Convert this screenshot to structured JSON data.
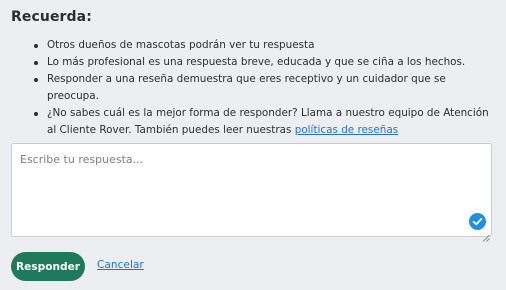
{
  "heading": "Recuerda:",
  "tips": [
    "Otros dueños de mascotas podrán ver tu respuesta",
    "Lo más profesional es una respuesta breve, educada y que se ciña a los hechos.",
    "Responder a una reseña demuestra que eres receptivo y un cuidador que se preocupa.",
    "¿No sabes cuál es la mejor forma de responder? Llama a nuestro equipo de Atención al Cliente Rover. También puedes leer nuestras "
  ],
  "policies_link": "políticas de reseñas",
  "reply": {
    "value": "",
    "placeholder": "Escribe tu respuesta..."
  },
  "icons": {
    "check": "check-circle-icon",
    "resize": "resize-handle-icon"
  },
  "actions": {
    "submit_label": "Responder",
    "cancel_label": "Cancelar"
  },
  "colors": {
    "background": "#eceef1",
    "primary_button": "#1e7a5a",
    "link": "#2470c8",
    "check_badge": "#1f8fe3"
  }
}
